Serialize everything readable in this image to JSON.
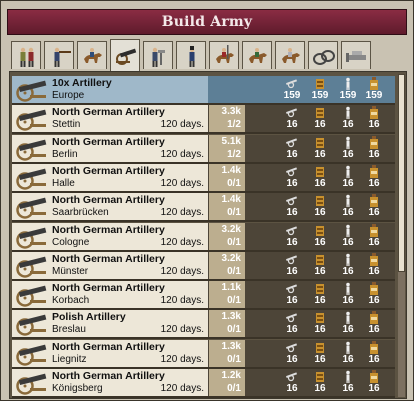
{
  "window": {
    "title": "Build Army"
  },
  "tabs": [
    {
      "icon": "infantry-pair-icon"
    },
    {
      "icon": "skirmisher-icon"
    },
    {
      "icon": "cavalry-icon"
    },
    {
      "icon": "artillery-icon"
    },
    {
      "icon": "engineer-icon"
    },
    {
      "icon": "guard-infantry-icon"
    },
    {
      "icon": "lancer-icon"
    },
    {
      "icon": "hussar-icon"
    },
    {
      "icon": "cuirassier-icon"
    },
    {
      "icon": "supply-icon"
    },
    {
      "icon": "balloon-icon"
    }
  ],
  "active_tab": 3,
  "rows": [
    {
      "name": "10x Artillery",
      "location": "Europe",
      "days": "",
      "cost": "",
      "count": "",
      "stats": [
        "159",
        "159",
        "159",
        "159"
      ],
      "selected": true
    },
    {
      "name": "North German Artillery",
      "location": "Stettin",
      "days": "120 days.",
      "cost": "3.3k",
      "count": "1/2",
      "stats": [
        "16",
        "16",
        "16",
        "16"
      ],
      "selected": false
    },
    {
      "name": "North German Artillery",
      "location": "Berlin",
      "days": "120 days.",
      "cost": "5.1k",
      "count": "1/2",
      "stats": [
        "16",
        "16",
        "16",
        "16"
      ],
      "selected": false
    },
    {
      "name": "North German Artillery",
      "location": "Halle",
      "days": "120 days.",
      "cost": "1.4k",
      "count": "0/1",
      "stats": [
        "16",
        "16",
        "16",
        "16"
      ],
      "selected": false
    },
    {
      "name": "North German Artillery",
      "location": "Saarbrücken",
      "days": "120 days.",
      "cost": "1.4k",
      "count": "0/1",
      "stats": [
        "16",
        "16",
        "16",
        "16"
      ],
      "selected": false
    },
    {
      "name": "North German Artillery",
      "location": "Cologne",
      "days": "120 days.",
      "cost": "3.2k",
      "count": "0/1",
      "stats": [
        "16",
        "16",
        "16",
        "16"
      ],
      "selected": false
    },
    {
      "name": "North German Artillery",
      "location": "Münster",
      "days": "120 days.",
      "cost": "3.2k",
      "count": "0/1",
      "stats": [
        "16",
        "16",
        "16",
        "16"
      ],
      "selected": false
    },
    {
      "name": "North German Artillery",
      "location": "Korbach",
      "days": "120 days.",
      "cost": "1.1k",
      "count": "0/1",
      "stats": [
        "16",
        "16",
        "16",
        "16"
      ],
      "selected": false
    },
    {
      "name": "Polish Artillery",
      "location": "Breslau",
      "days": "120 days.",
      "cost": "1.3k",
      "count": "0/1",
      "stats": [
        "16",
        "16",
        "16",
        "16"
      ],
      "selected": false
    },
    {
      "name": "North German Artillery",
      "location": "Liegnitz",
      "days": "120 days.",
      "cost": "1.3k",
      "count": "0/1",
      "stats": [
        "16",
        "16",
        "16",
        "16"
      ],
      "selected": false
    },
    {
      "name": "North German Artillery",
      "location": "Königsberg",
      "days": "120 days.",
      "cost": "1.2k",
      "count": "0/1",
      "stats": [
        "16",
        "16",
        "16",
        "16"
      ],
      "selected": false
    }
  ],
  "stat_icons": [
    "crossed-cannon-icon",
    "ammunition-box-icon",
    "soldier-icon",
    "bottle-icon"
  ],
  "colors": {
    "title_bar": "#7a243a",
    "selected_row": "#5d7f96",
    "cost_box": "#bcae8f",
    "list_bg": "#4d4538"
  }
}
